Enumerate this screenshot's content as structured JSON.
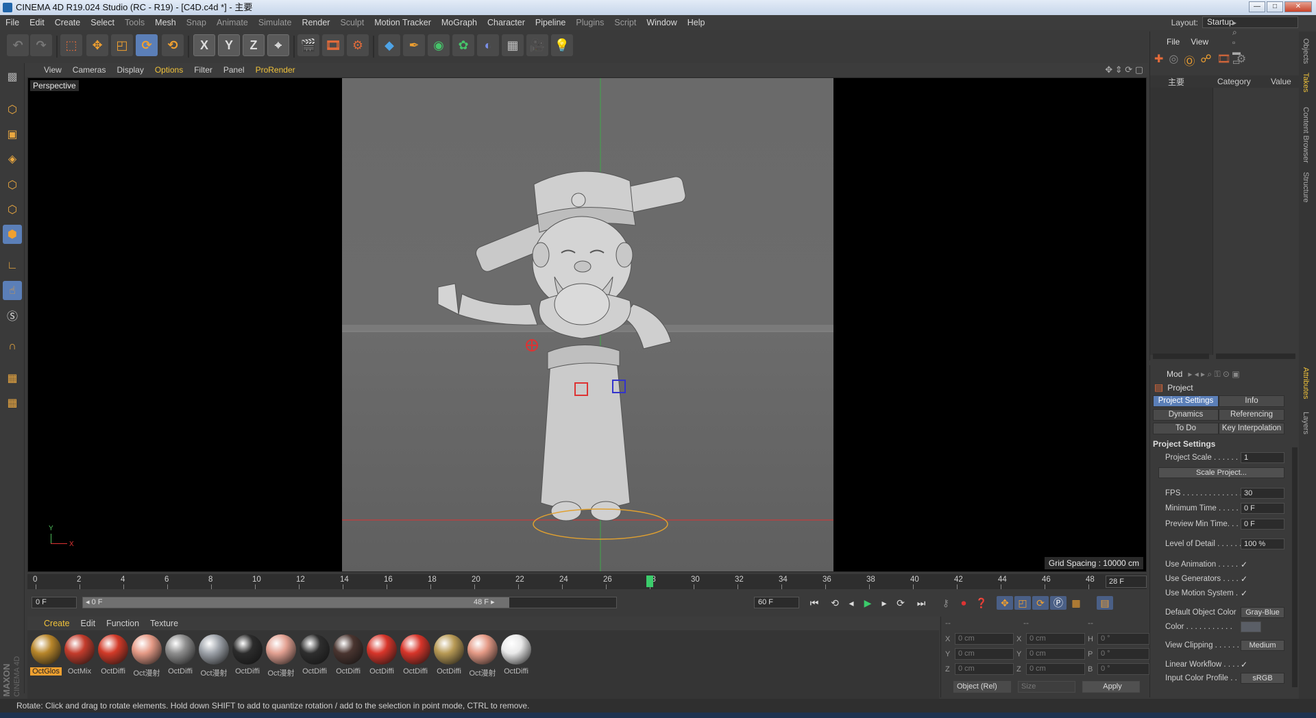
{
  "window": {
    "title": "CINEMA 4D R19.024 Studio (RC - R19) - [C4D.c4d *] - 主要",
    "buttons": {
      "minimize": "—",
      "maximize": "□",
      "close": "✕"
    }
  },
  "menubar": {
    "items": [
      "File",
      "Edit",
      "Create",
      "Select",
      "Tools",
      "Mesh",
      "Snap",
      "Animate",
      "Simulate",
      "Render",
      "Sculpt",
      "Motion Tracker",
      "MoGraph",
      "Character",
      "Pipeline",
      "Plugins",
      "Script",
      "Window",
      "Help"
    ],
    "layout_label": "Layout:",
    "layout_value": "Startup"
  },
  "toolbar": {
    "axes": [
      "X",
      "Y",
      "Z"
    ]
  },
  "viewport": {
    "menu": [
      "View",
      "Cameras",
      "Display",
      "Options",
      "Filter",
      "Panel",
      "ProRender"
    ],
    "active_menu": "Options",
    "label": "Perspective",
    "grid_spacing": "Grid Spacing : 10000 cm",
    "axis_y": "Y",
    "axis_x": "X"
  },
  "timeline": {
    "ticks": [
      "0",
      "2",
      "4",
      "6",
      "8",
      "10",
      "12",
      "14",
      "16",
      "18",
      "20",
      "22",
      "24",
      "26",
      "28",
      "30",
      "32",
      "34",
      "36",
      "38",
      "40",
      "42",
      "44",
      "46",
      "48"
    ],
    "current_frame": 28,
    "current_frame_box": "28 F"
  },
  "playback": {
    "start_field": "0 F",
    "range_start": "◂ 0 F",
    "range_end": "48 F ▸",
    "end_field": "60 F",
    "range_fraction": 0.8
  },
  "materials": {
    "menu": [
      "Create",
      "Edit",
      "Function",
      "Texture"
    ],
    "items": [
      {
        "label": "OctGlos",
        "color": "#b8862a",
        "selected": true
      },
      {
        "label": "OctMix",
        "color": "#c43c2c",
        "selected": false
      },
      {
        "label": "OctDiffi",
        "color": "#d23a28",
        "selected": false
      },
      {
        "label": "Oct漫射",
        "color": "#e59a86",
        "selected": false
      },
      {
        "label": "OctDiffi",
        "color": "#8e8e8e",
        "selected": false
      },
      {
        "label": "Oct漫射",
        "color": "#9ea3aa",
        "selected": false
      },
      {
        "label": "OctDiffi",
        "color": "#2c2c2c",
        "selected": false
      },
      {
        "label": "Oct漫射",
        "color": "#e3a192",
        "selected": false
      },
      {
        "label": "OctDiffi",
        "color": "#2e2e2e",
        "selected": false
      },
      {
        "label": "OctDiffi",
        "color": "#4a3530",
        "selected": false
      },
      {
        "label": "OctDiffi",
        "color": "#d8352a",
        "selected": false
      },
      {
        "label": "OctDiffi",
        "color": "#d8352a",
        "selected": false
      },
      {
        "label": "OctDiffi",
        "color": "#b89a55",
        "selected": false
      },
      {
        "label": "Oct漫射",
        "color": "#e59a86",
        "selected": false
      },
      {
        "label": "OctDiffi",
        "color": "#e9e9e9",
        "selected": false
      }
    ]
  },
  "coordinates": {
    "headers": [
      "--",
      "--",
      "--"
    ],
    "rows": [
      {
        "a": "X",
        "av": "0 cm",
        "b": "X",
        "bv": "0 cm",
        "c": "H",
        "cv": "0 °"
      },
      {
        "a": "Y",
        "av": "0 cm",
        "b": "Y",
        "bv": "0 cm",
        "c": "P",
        "cv": "0 °"
      },
      {
        "a": "Z",
        "av": "0 cm",
        "b": "Z",
        "bv": "0 cm",
        "c": "B",
        "cv": "0 °"
      }
    ],
    "mode": "Object (Rel)",
    "size": "Size",
    "apply": "Apply"
  },
  "object_manager": {
    "menu": [
      "File",
      "View"
    ],
    "col_name": "主要",
    "col_category": "Category",
    "col_value": "Value"
  },
  "attributes": {
    "mode": "Mod",
    "title": "Project",
    "tabs": [
      {
        "label": "Project Settings",
        "active": true
      },
      {
        "label": "Info",
        "active": false
      },
      {
        "label": "Dynamics",
        "active": false
      },
      {
        "label": "Referencing",
        "active": false
      },
      {
        "label": "To Do",
        "active": false
      },
      {
        "label": "Key Interpolation",
        "active": false
      }
    ],
    "section": "Project Settings",
    "project_scale_label": "Project Scale . . . . . .",
    "project_scale": "1",
    "scale_project": "Scale Project...",
    "fps_label": "FPS . . . . . . . . . . . . . .",
    "fps": "30",
    "min_time_label": "Minimum Time . . . . .",
    "min_time": "0 F",
    "preview_min_label": "Preview Min Time. . .",
    "preview_min": "0 F",
    "lod_label": "Level of Detail . . . . . .",
    "lod": "100 %",
    "use_animation": "Use Animation . . . . . .",
    "use_generators": "Use Generators . . . . .",
    "use_motion": "Use Motion System . .",
    "default_color_label": "Default Object Color",
    "default_color": "Gray-Blue",
    "color_label": "Color . . . . . . . . . . .",
    "view_clipping_label": "View Clipping . . . . . .",
    "view_clipping": "Medium",
    "linear_workflow": "Linear Workflow . . . .",
    "input_color_label": "Input Color Profile . .",
    "input_color": "sRGB",
    "check": "✓"
  },
  "right_tabs": [
    "Objects",
    "Takes",
    "Content Browser",
    "Structure",
    "Attributes",
    "Layers"
  ],
  "status": "Rotate: Click and drag to rotate elements. Hold down SHIFT to add to quantize rotation / add to the selection in point mode, CTRL to remove."
}
